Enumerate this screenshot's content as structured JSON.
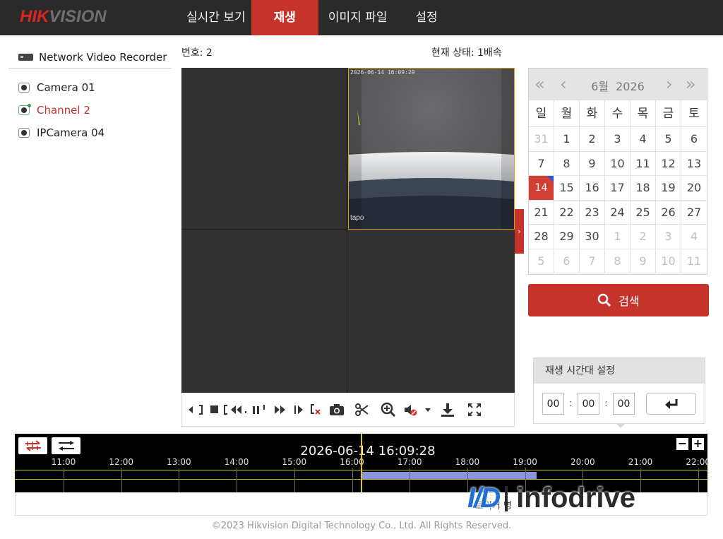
{
  "brand": {
    "logo_hik": "HIK",
    "logo_vision": "VISION"
  },
  "nav": {
    "items": [
      {
        "label": "실시간 보기"
      },
      {
        "label": "재생"
      },
      {
        "label": "이미지 파일"
      },
      {
        "label": "설정"
      }
    ],
    "active": "재생"
  },
  "sidebar": {
    "header": "Network Video Recorder",
    "cameras": [
      {
        "label": "Camera 01"
      },
      {
        "label": "Channel 2",
        "selected": true
      },
      {
        "label": "IPCamera 04"
      }
    ]
  },
  "playback": {
    "number_label": "번호: 2",
    "status_label": "현재 상태: 1배속",
    "feed_timestamp": "2026-06-14 16:09:29",
    "feed_brand": "tapo"
  },
  "controls": {
    "icons": [
      "rewind-frame-icon",
      "stop-icon",
      "slow-icon",
      "pause-icon",
      "fast-forward-icon",
      "frame-step-icon",
      "clip-delete-icon",
      "camera-capture-icon",
      "scissors-icon",
      "zoom-in-icon",
      "mute-icon",
      "dropdown-icon",
      "download-icon",
      "fullscreen-icon"
    ]
  },
  "calendar": {
    "month": "6월",
    "year": "2026",
    "weekdays": [
      "일",
      "월",
      "화",
      "수",
      "목",
      "금",
      "토"
    ],
    "days": [
      "31",
      "1",
      "2",
      "3",
      "4",
      "5",
      "6",
      "7",
      "8",
      "9",
      "10",
      "11",
      "12",
      "13",
      "14",
      "15",
      "16",
      "17",
      "18",
      "19",
      "20",
      "21",
      "22",
      "23",
      "24",
      "25",
      "26",
      "27",
      "28",
      "29",
      "30",
      "1",
      "2",
      "3",
      "4",
      "5",
      "6",
      "7",
      "8",
      "9",
      "10",
      "11"
    ],
    "other_month": [
      0,
      31,
      32,
      33,
      34,
      35,
      36,
      37,
      38,
      39,
      40,
      41
    ],
    "today_index": 14,
    "nav_first": "«",
    "nav_prev": "‹",
    "nav_next": "›",
    "nav_last": "»"
  },
  "search": {
    "label": "검색"
  },
  "time_setting": {
    "title": "재생 시간대 설정",
    "hour": "00",
    "minute": "00",
    "second": "00",
    "sep": ":"
  },
  "timeline": {
    "datetime": "2026-06-14 16:09:28",
    "zoom_out": "−",
    "zoom_in": "+",
    "hours": [
      "11:00",
      "12:00",
      "13:00",
      "14:00",
      "15:00",
      "16:00",
      "17:00",
      "18:00",
      "19:00",
      "20:00",
      "21:00",
      "22:00"
    ],
    "recording_segment": {
      "start": "16:09",
      "end": "19:12"
    },
    "legend_partial": "트리거 명"
  },
  "watermark": {
    "mark": "I/D",
    "text": "infodrive"
  },
  "footer": "©2023 Hikvision Digital Technology Co., Ltd. All Rights Reserved.",
  "colors": {
    "accent": "#c5332b",
    "topbar": "#2a2a2a",
    "timeline_cursor": "#e8c31c",
    "recording": "#8a93de"
  }
}
